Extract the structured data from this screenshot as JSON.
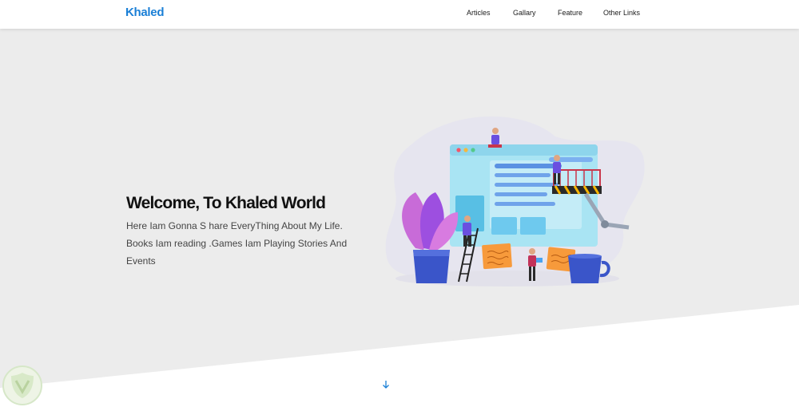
{
  "header": {
    "logo": "Khaled",
    "nav": [
      {
        "label": "Articles"
      },
      {
        "label": "Gallary"
      },
      {
        "label": "Feature"
      },
      {
        "label": "Other Links"
      }
    ]
  },
  "hero": {
    "title": "Welcome, To Khaled World",
    "description": "Here Iam Gonna S hare EveryThing About My Life. Books Iam reading .Games Iam Playing Stories And Events"
  },
  "scroll_down_icon": "arrow-down-icon",
  "colors": {
    "brand": "#1a7fd6",
    "hero_bg": "#ececec",
    "page_bg": "#ffffff"
  }
}
